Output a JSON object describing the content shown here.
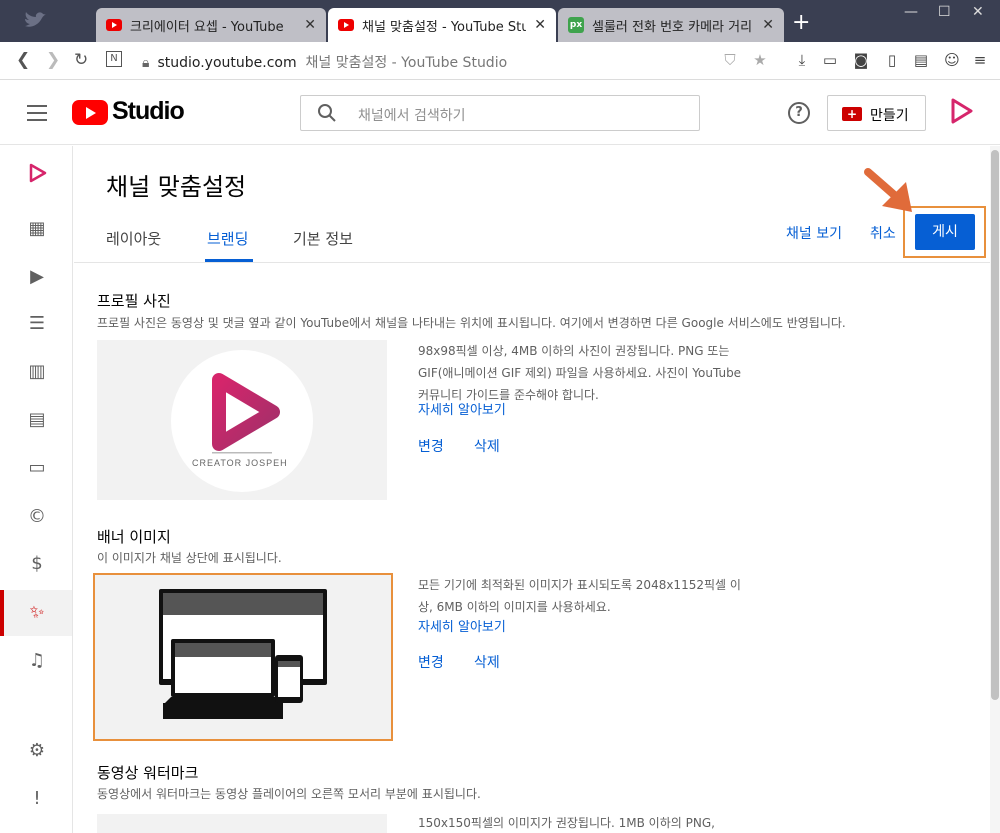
{
  "browser": {
    "tabs": [
      {
        "title": "크리에이터 요셉 - YouTube",
        "active": false
      },
      {
        "title": "채널 맞춤설정 - YouTube Studio",
        "active": true
      },
      {
        "title": "셀룰러 전화 번호 카메라 거리",
        "active": false,
        "favicon_text": "px"
      }
    ],
    "new_tab": "+",
    "url_domain": "studio.youtube.com",
    "url_title": "채널 맞춤설정 - YouTube Studio"
  },
  "header": {
    "logo_text": "Studio",
    "search_placeholder": "채널에서 검색하기",
    "help": "?",
    "create_label": "만들기"
  },
  "page": {
    "title": "채널 맞춤설정",
    "tabs": [
      "레이아웃",
      "브랜딩",
      "기본 정보"
    ],
    "active_tab": "브랜딩",
    "view_channel": "채널 보기",
    "cancel": "취소",
    "publish": "게시"
  },
  "sections": {
    "profile": {
      "title": "프로필 사진",
      "desc": "프로필 사진은 동영상 및 댓글 옆과 같이 YouTube에서 채널을 나타내는 위치에 표시됩니다. 여기에서 변경하면 다른 Google 서비스에도 반영됩니다.",
      "info": "98x98픽셀 이상, 4MB 이하의 사진이 권장됩니다. PNG 또는 GIF(애니메이션 GIF 제외) 파일을 사용하세요. 사진이 YouTube 커뮤니티 가이드를 준수해야 합니다.",
      "learn_more": "자세히 알아보기",
      "change": "변경",
      "remove": "삭제",
      "avatar_caption": "CREATOR JOSPEH"
    },
    "banner": {
      "title": "배너 이미지",
      "desc": "이 이미지가 채널 상단에 표시됩니다.",
      "info": "모든 기기에 최적화된 이미지가 표시되도록 2048x1152픽셀 이상, 6MB 이하의 이미지를 사용하세요.",
      "learn_more": "자세히 알아보기",
      "change": "변경",
      "remove": "삭제"
    },
    "watermark": {
      "title": "동영상 워터마크",
      "desc": "동영상에서 워터마크는 동영상 플레이어의 오른쪽 모서리 부분에 표시됩니다.",
      "info": "150x150픽셀의 이미지가 권장됩니다. 1MB 이하의 PNG,"
    }
  },
  "colors": {
    "accent": "#065fd4",
    "highlight": "#e8903c",
    "brand_red": "#ff0000",
    "logo_pink": "#d6256b"
  }
}
